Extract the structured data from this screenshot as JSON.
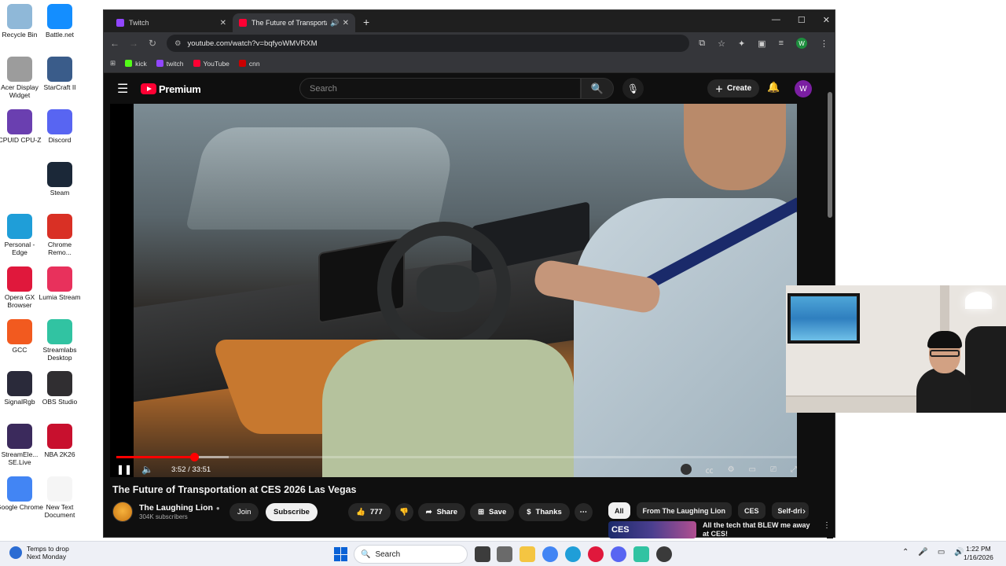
{
  "desktop_icons": [
    {
      "label": "Recycle Bin",
      "icon": "recycle-bin-icon",
      "color": "#8fb8d8"
    },
    {
      "label": "Battle.net",
      "icon": "battlenet-icon",
      "color": "#148eff"
    },
    {
      "label": "Acer Display Widget",
      "icon": "display-widget-icon",
      "color": "#9c9c9c"
    },
    {
      "label": "StarCraft II",
      "icon": "starcraft-icon",
      "color": "#3a5c8a"
    },
    {
      "label": "CPUID CPU-Z",
      "icon": "cpuz-icon",
      "color": "#6a3fb0"
    },
    {
      "label": "Discord",
      "icon": "discord-icon",
      "color": "#5865f2"
    },
    {
      "label": "Steam",
      "icon": "steam-icon",
      "color": "#1b2838"
    },
    {
      "label": "Personal - Edge",
      "icon": "edge-icon",
      "color": "#1f9ed8"
    },
    {
      "label": "Chrome Remo...",
      "icon": "chrome-remote-icon",
      "color": "#d93025"
    },
    {
      "label": "Opera GX Browser",
      "icon": "opera-gx-icon",
      "color": "#e0183c"
    },
    {
      "label": "Lumia Stream",
      "icon": "lumia-icon",
      "color": "#e8315c"
    },
    {
      "label": "GCC",
      "icon": "gcc-icon",
      "color": "#f25a1f"
    },
    {
      "label": "Streamlabs Desktop",
      "icon": "streamlabs-icon",
      "color": "#31c3a2"
    },
    {
      "label": "SignalRgb",
      "icon": "signalrgb-icon",
      "color": "#2a2a3a"
    },
    {
      "label": "OBS Studio",
      "icon": "obs-icon",
      "color": "#302e31"
    },
    {
      "label": "StreamEle... SE.Live",
      "icon": "streamelements-icon",
      "color": "#3b2a5c"
    },
    {
      "label": "NBA 2K26",
      "icon": "nba2k-icon",
      "color": "#c8102e"
    },
    {
      "label": "Google Chrome",
      "icon": "chrome-icon",
      "color": "#4285f4"
    },
    {
      "label": "New Text Document",
      "icon": "text-document-icon",
      "color": "#f5f5f5"
    }
  ],
  "browser": {
    "tabs": [
      {
        "title": "Twitch",
        "favicon_color": "#9146ff",
        "active": false
      },
      {
        "title": "The Future of Transportation at CES 2026 Las Vegas",
        "favicon_color": "#ff0033",
        "active": true
      }
    ],
    "url": "youtube.com/watch?v=bqfyoWMVRXM",
    "bookmarks": [
      {
        "label": "kick",
        "color": "#53fc18"
      },
      {
        "label": "twitch",
        "color": "#9146ff"
      },
      {
        "label": "YouTube",
        "color": "#ff0033"
      },
      {
        "label": "cnn",
        "color": "#cc0000"
      }
    ],
    "profile_initial": "W"
  },
  "youtube": {
    "brand": "Premium",
    "search_placeholder": "Search",
    "create_label": "Create",
    "avatar_initial": "W",
    "player": {
      "current_time": "3:52",
      "duration": "33:51",
      "time_display": "3:52 / 33:51",
      "progress_fraction": 0.114
    },
    "video": {
      "title": "The Future of Transportation at CES 2026 Las Vegas",
      "channel": "The Laughing Lion",
      "subscribers": "304K subscribers",
      "join_label": "Join",
      "subscribe_label": "Subscribe",
      "likes": "777",
      "share_label": "Share",
      "save_label": "Save",
      "thanks_label": "Thanks"
    },
    "chips": [
      "All",
      "From The Laughing Lion",
      "CES",
      "Self-dri"
    ],
    "recommended": {
      "thumb_text": "CES",
      "title": "All the tech that BLEW me away at CES!"
    }
  },
  "taskbar": {
    "weather_line1": "Temps to drop",
    "weather_line2": "Next Monday",
    "search_label": "Search",
    "time": "1:22 PM",
    "date": "1/16/2026"
  }
}
